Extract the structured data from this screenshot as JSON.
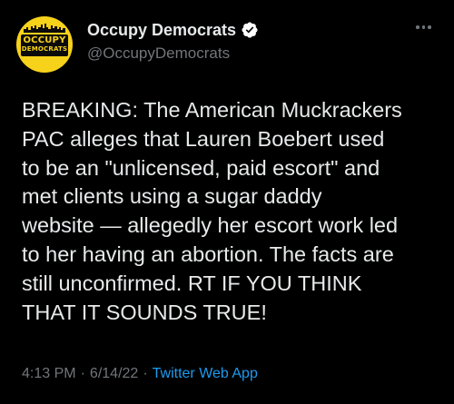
{
  "colors": {
    "background": "#000000",
    "text": "#e7e9ea",
    "muted": "#71767b",
    "link": "#1d9bf0",
    "verified": "#ffffff",
    "avatar_bg": "#f7d21b"
  },
  "author": {
    "display_name": "Occupy Democrats",
    "handle": "@OccupyDemocrats",
    "verified_icon": "verified-badge-icon",
    "avatar_text_line1": "OCCUPY",
    "avatar_text_line2": "DEMOCRATS"
  },
  "more_icon": "more-horizontal-icon",
  "tweet": {
    "text": "BREAKING: The American Muckrackers\nPAC alleges that Lauren Boebert used\nto be an \"unlicensed, paid escort\" and\nmet clients using a sugar daddy\nwebsite — allegedly her escort work led\nto her having an abortion. The facts are\nstill unconfirmed. RT IF YOU THINK\nTHAT IT SOUNDS TRUE!"
  },
  "meta": {
    "time": "4:13 PM",
    "separator": "·",
    "date": "6/14/22",
    "separator2": "·",
    "source": "Twitter Web App"
  }
}
